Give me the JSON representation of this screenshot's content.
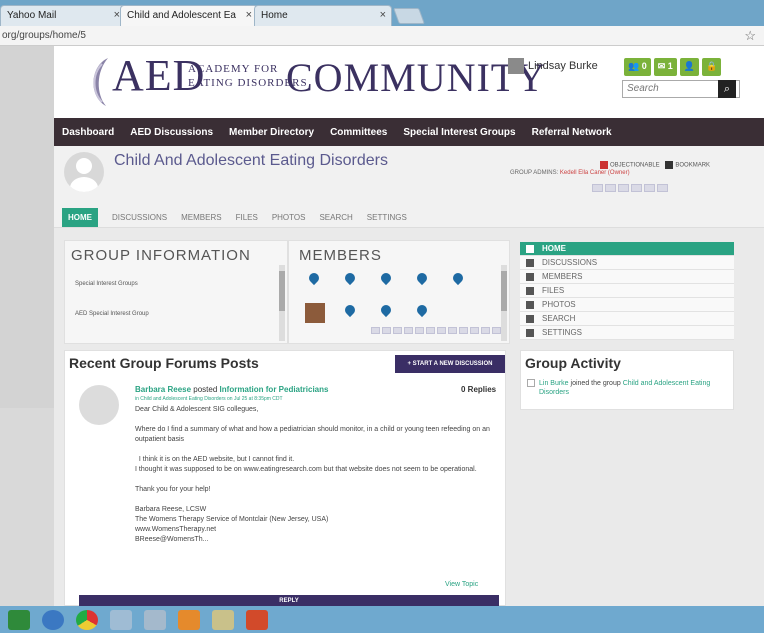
{
  "browser": {
    "tabs": [
      {
        "label": "Yahoo Mail",
        "close": "×"
      },
      {
        "label": "Child and Adolescent Ea",
        "close": "×"
      },
      {
        "label": "Home",
        "close": "×"
      }
    ],
    "url": "org/groups/home/5",
    "star_icon": "star-icon"
  },
  "header": {
    "logo_main": "AED",
    "logo_sub_line1": "Academy for",
    "logo_sub_line2": "Eating Disorders",
    "logo_community": "COMMUNITY",
    "user_name": "Lindsay Burke",
    "badges": [
      "0",
      "1",
      "",
      ""
    ],
    "search_placeholder": "Search"
  },
  "nav": {
    "items": [
      "Dashboard",
      "AED Discussions",
      "Member Directory",
      "Committees",
      "Special Interest Groups",
      "Referral Network"
    ]
  },
  "group": {
    "title": "Child And Adolescent Eating Disorders",
    "admins_label": "GROUP ADMINS:",
    "admins": "Kedell   Ella Caner (Owner)",
    "objectionable": "OBJECTIONABLE",
    "bookmark": "BOOKMARK"
  },
  "tabs": [
    "HOME",
    "DISCUSSIONS",
    "MEMBERS",
    "FILES",
    "PHOTOS",
    "SEARCH",
    "SETTINGS"
  ],
  "group_info": {
    "heading": "GROUP INFORMATION",
    "items": [
      "Special Interest Groups",
      "AED Special Interest Group"
    ]
  },
  "members": {
    "heading": "MEMBERS"
  },
  "sidenav": {
    "items": [
      "HOME",
      "DISCUSSIONS",
      "MEMBERS",
      "FILES",
      "PHOTOS",
      "SEARCH",
      "SETTINGS"
    ]
  },
  "forum": {
    "heading": "Recent Group Forums Posts",
    "start_button": "+ START A NEW DISCUSSION",
    "post": {
      "author": "Barbara Reese",
      "posted": "posted",
      "topic": "Information for Pediatricians",
      "meta": "in Child and Adolescent Eating Disorders on Jul 25 at 8:35pm CDT",
      "replies": "0 Replies",
      "body": "Dear Child & Adolescent SIG collegues,\n\nWhere do I find a summary of what and how a pediatrician should monitor, in a child or young teen refeeding on an outpatient basis\n\n  I think it is on the AED website, but I cannot find it.\nI thought it was supposed to be on www.eatingresearch.com but that website does not seem to be operational.\n\nThank you for your help!\n\nBarbara Reese, LCSW\nThe Womens Therapy Service of Montclair (New Jersey, USA)\nwww.WomensTherapy.net\nBReese@WomensTh...",
      "view_topic": "View Topic",
      "reply": "REPLY"
    }
  },
  "activity": {
    "heading": "Group Activity",
    "actor": "Lin Burke",
    "action": "joined the group",
    "group": "Child and Adolescent Eating Disorders"
  },
  "colors": {
    "nav_bg": "#3a2e35",
    "accent_green": "#2aa383",
    "brand_purple": "#3b3161",
    "button_purple": "#3a2e65"
  }
}
